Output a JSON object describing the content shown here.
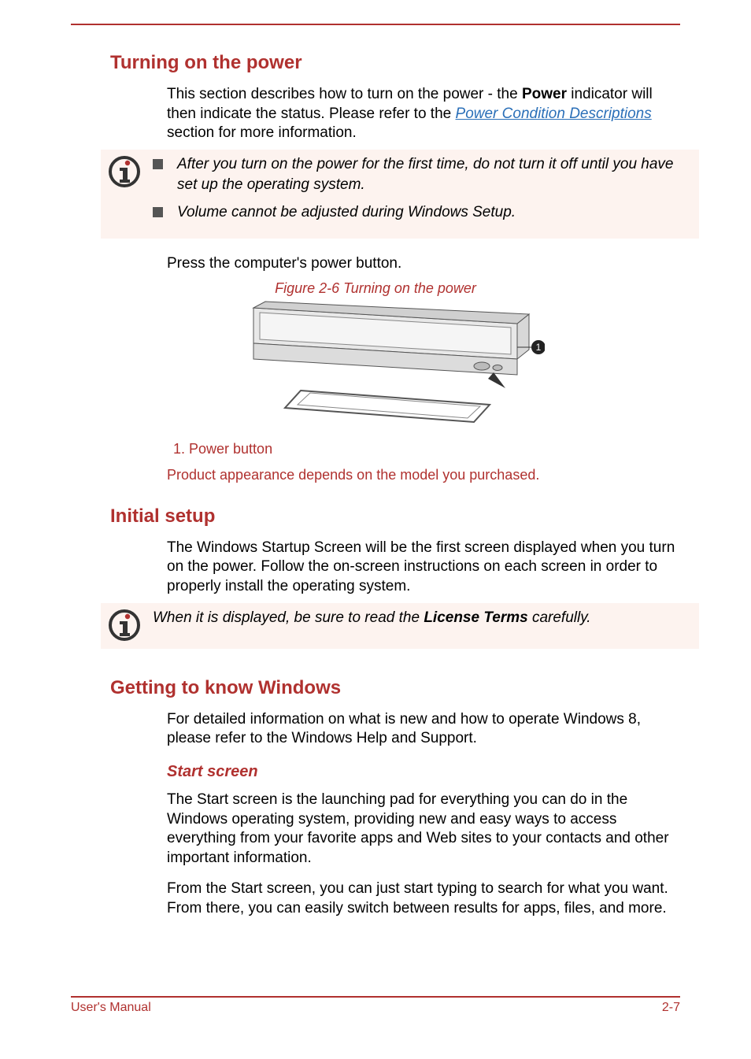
{
  "section1": {
    "title": "Turning on the power",
    "para1_a": "This section describes how to turn on the power - the ",
    "para1_bold": "Power",
    "para1_b": " indicator will then indicate the status. Please refer to the ",
    "para1_link": "Power Condition Descriptions",
    "para1_c": " section for more information.",
    "note_items": [
      "After you turn on the power for the first time, do not turn it off until you have set up the operating system.",
      "Volume cannot be adjusted during Windows Setup."
    ],
    "press_text": "Press the computer's power button.",
    "figure_caption": "Figure 2-6 Turning on the power",
    "figure_legend": "1. Power button",
    "product_note": "Product appearance depends on the model you purchased."
  },
  "section2": {
    "title": "Initial setup",
    "para": "The Windows Startup Screen will be the first screen displayed when you turn on the power. Follow the on-screen instructions on each screen in order to properly install the operating system.",
    "note_a": "When it is displayed, be sure to read the ",
    "note_bold": "License Terms",
    "note_b": " carefully."
  },
  "section3": {
    "title": "Getting to know Windows",
    "para1": "For detailed information on what is new and how to operate Windows 8, please refer to the Windows Help and Support.",
    "sub_title": "Start screen",
    "para2": "The Start screen is the launching pad for everything you can do in the Windows operating system, providing new and easy ways to access everything from your favorite apps and Web sites to your contacts and other important information.",
    "para3": "From the Start screen, you can just start typing to search for what you want. From there, you can easily switch between results for apps, files, and more."
  },
  "footer": {
    "left": "User's Manual",
    "right": "2-7"
  },
  "icons": {
    "info": "info-icon",
    "callout": "1"
  }
}
